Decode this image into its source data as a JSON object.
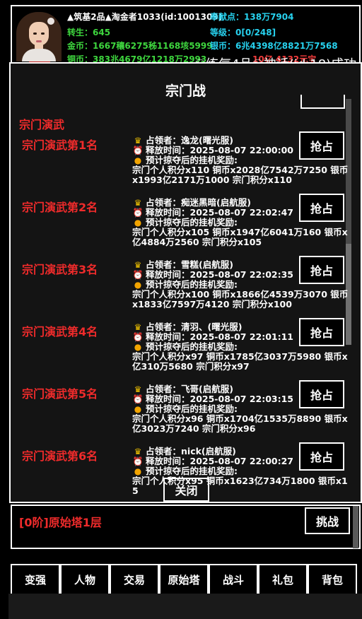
{
  "header": {
    "name_line": "▲筑基2品▲淘金者1033(id:1001309)",
    "contribution_label": "奉献点：",
    "contribution_value": "138万7904",
    "cultivation_label": "转生：",
    "cultivation_value": "645",
    "level_label": "等级：",
    "level_value": "0[0/248]",
    "gold_label": "金币：",
    "gold_value": "1667穰6275秭1168垓5999",
    "silver_label": "银币：",
    "silver_value": "6兆4398亿8821万7568",
    "copper_label": "铜币：",
    "copper_value": "383兆4679亿1218万2993",
    "red_value": "10亿 4132元宝"
  },
  "notice": "☯练气4品☯神话(id:18)成功",
  "modal": {
    "title": "宗门战",
    "section_title": "宗门演武",
    "grab_label": "抢占",
    "close_label": "关闭",
    "occupant_label": "占领者：",
    "release_label": "释放时间：",
    "reward_label": "预计掠夺后的挂机奖励:",
    "ranks": [
      {
        "rank": "宗门演武第1名",
        "occupant": "逸龙(曙光服)",
        "time": "2025-08-07 22:00:00",
        "reward": "宗门个人积分x110 铜币x2028亿7542万7250 银币x1993亿2171万1000 宗门积分x110"
      },
      {
        "rank": "宗门演武第2名",
        "occupant": "痴迷黑暗(启航服)",
        "time": "2025-08-07 22:02:47",
        "reward": "宗门个人积分x105 铜币x1947亿6041万160 银币x亿4884万2560 宗门积分x105"
      },
      {
        "rank": "宗门演武第3名",
        "occupant": "雪糕(启航服)",
        "time": "2025-08-07 22:02:35",
        "reward": "宗门个人积分x100 铜币x1866亿4539万3070 银币x1833亿7597万4120 宗门积分x100"
      },
      {
        "rank": "宗门演武第4名",
        "occupant": "清羽、(曙光服)",
        "time": "2025-08-07 22:01:11",
        "reward": "宗门个人积分x97 铜币x1785亿3037万5980 银币x亿310万5680 宗门积分x97"
      },
      {
        "rank": "宗门演武第5名",
        "occupant": "飞哥(启航服)",
        "time": "2025-08-07 22:03:15",
        "reward": "宗门个人积分x96 铜币x1704亿1535万8890 银币x亿3023万7240 宗门积分x96"
      },
      {
        "rank": "宗门演武第6名",
        "occupant": "nick(启航服)",
        "time": "2025-08-07 22:00:27",
        "reward": "宗门个人积分x95 铜币x1623亿734万1800 银币x15"
      }
    ]
  },
  "tower": {
    "name": "[0阶]原始塔1层",
    "challenge_label": "挑战"
  },
  "nav": [
    "变强",
    "人物",
    "交易",
    "原始塔",
    "战斗",
    "礼包",
    "背包"
  ]
}
